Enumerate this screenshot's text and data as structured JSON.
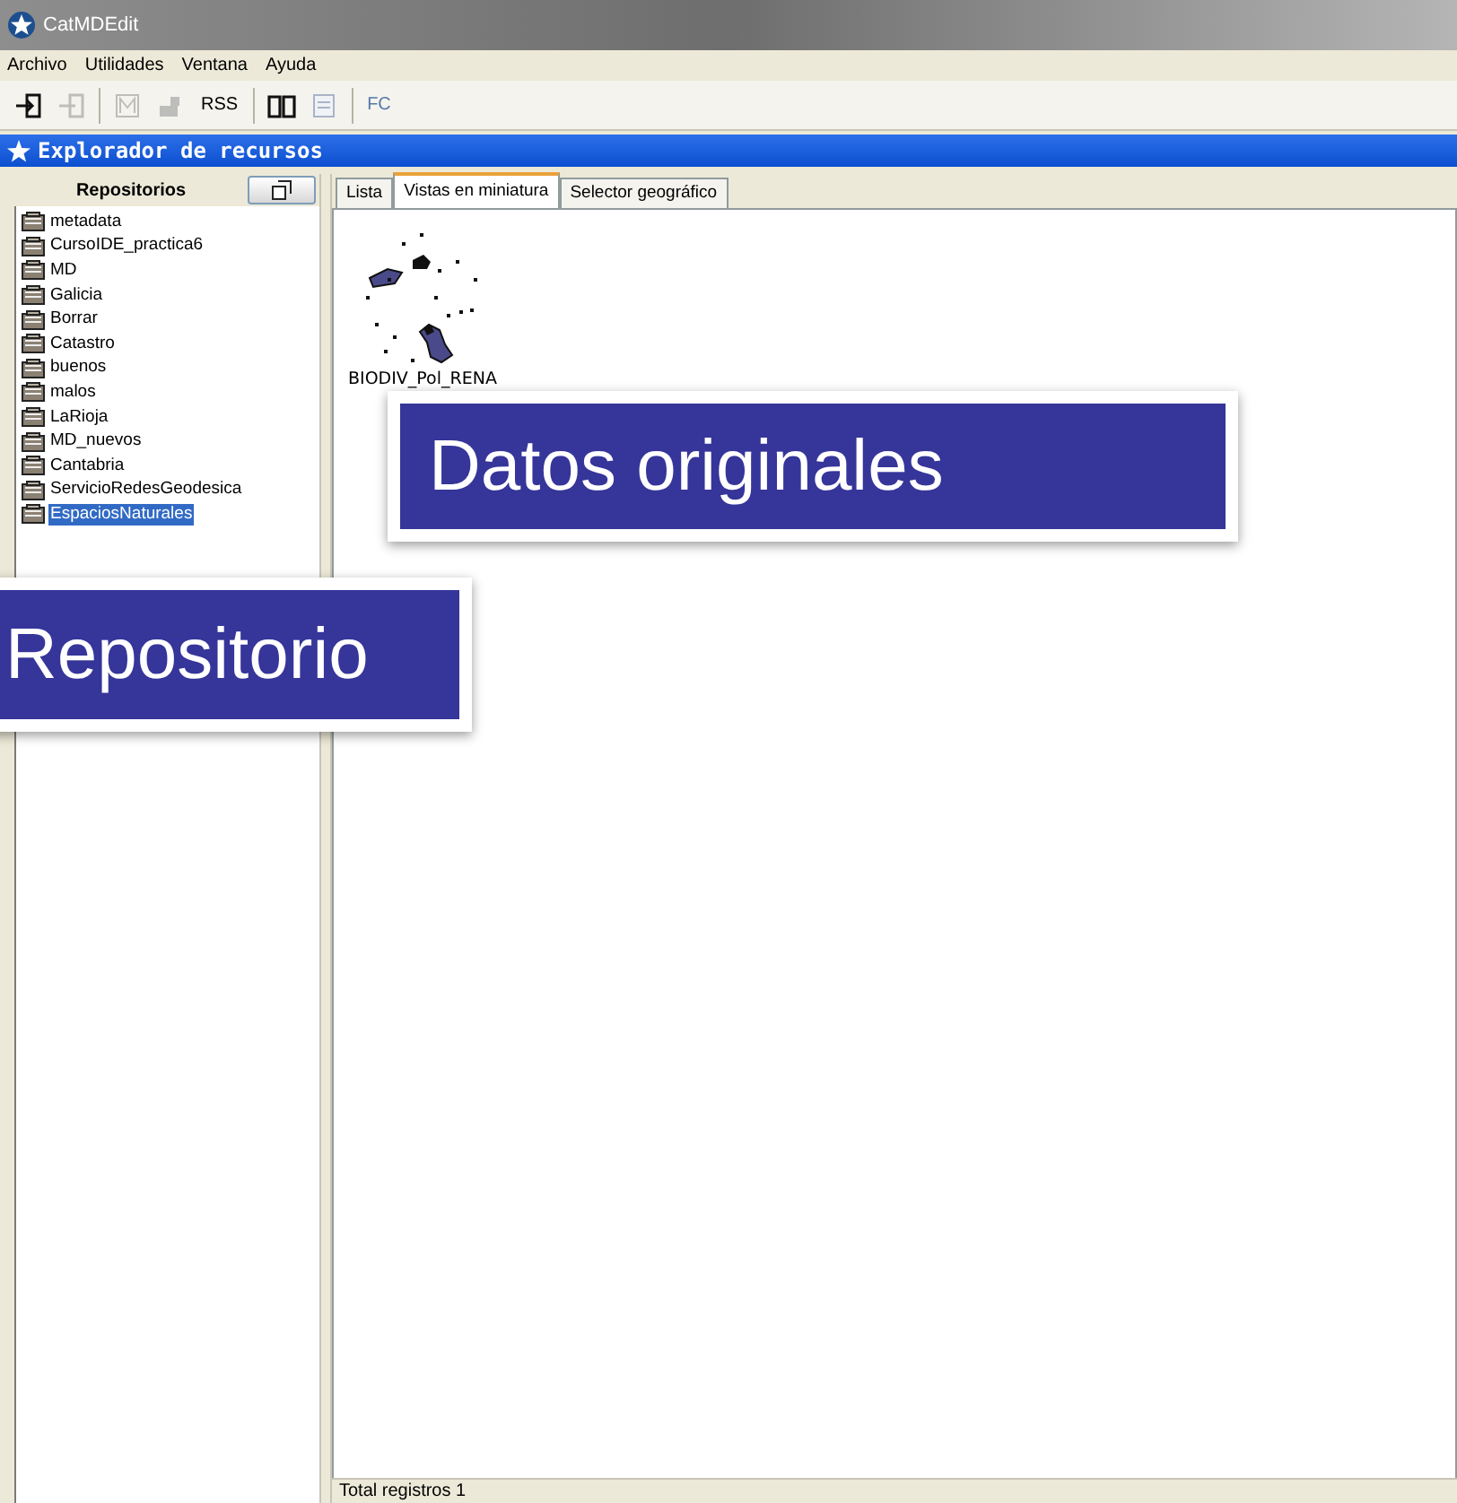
{
  "window": {
    "title": "CatMDEdit"
  },
  "menu": [
    "Archivo",
    "Utilidades",
    "Ventana",
    "Ayuda"
  ],
  "toolbar": [
    {
      "kind": "icon",
      "disabled": false
    },
    {
      "kind": "icon",
      "disabled": true
    },
    {
      "kind": "separator"
    },
    {
      "kind": "icon",
      "disabled": true
    },
    {
      "kind": "icon",
      "disabled": true
    },
    {
      "kind": "text",
      "label": "RSS",
      "disabled": false
    },
    {
      "kind": "separator"
    },
    {
      "kind": "icon",
      "disabled": false
    },
    {
      "kind": "icon",
      "disabled": true
    },
    {
      "kind": "separator"
    },
    {
      "kind": "text",
      "label": "FC",
      "disabled": true
    }
  ],
  "frame": {
    "title": "Explorador de recursos"
  },
  "sidebar": {
    "header": "Repositorios",
    "items": [
      {
        "label": "metadata",
        "selected": false
      },
      {
        "label": "CursoIDE_practica6",
        "selected": false
      },
      {
        "label": "MD",
        "selected": false
      },
      {
        "label": "Galicia",
        "selected": false
      },
      {
        "label": "Borrar",
        "selected": false
      },
      {
        "label": "Catastro",
        "selected": false
      },
      {
        "label": "buenos",
        "selected": false
      },
      {
        "label": "malos",
        "selected": false
      },
      {
        "label": "LaRioja",
        "selected": false
      },
      {
        "label": "MD_nuevos",
        "selected": false
      },
      {
        "label": "Cantabria",
        "selected": false
      },
      {
        "label": "ServicioRedesGeodesica",
        "selected": false
      },
      {
        "label": "EspaciosNaturales",
        "selected": true
      }
    ]
  },
  "tabs": [
    {
      "label": "Lista",
      "selected": false
    },
    {
      "label": "Vistas en miniatura",
      "selected": true
    },
    {
      "label": "Selector geográfico",
      "selected": false
    }
  ],
  "thumbnails": [
    {
      "label": "BIODIV_Pol_RENA"
    }
  ],
  "callouts": [
    {
      "label": "Datos originales"
    },
    {
      "label": "Repositorio"
    }
  ],
  "status_bar": "Total registros 1"
}
